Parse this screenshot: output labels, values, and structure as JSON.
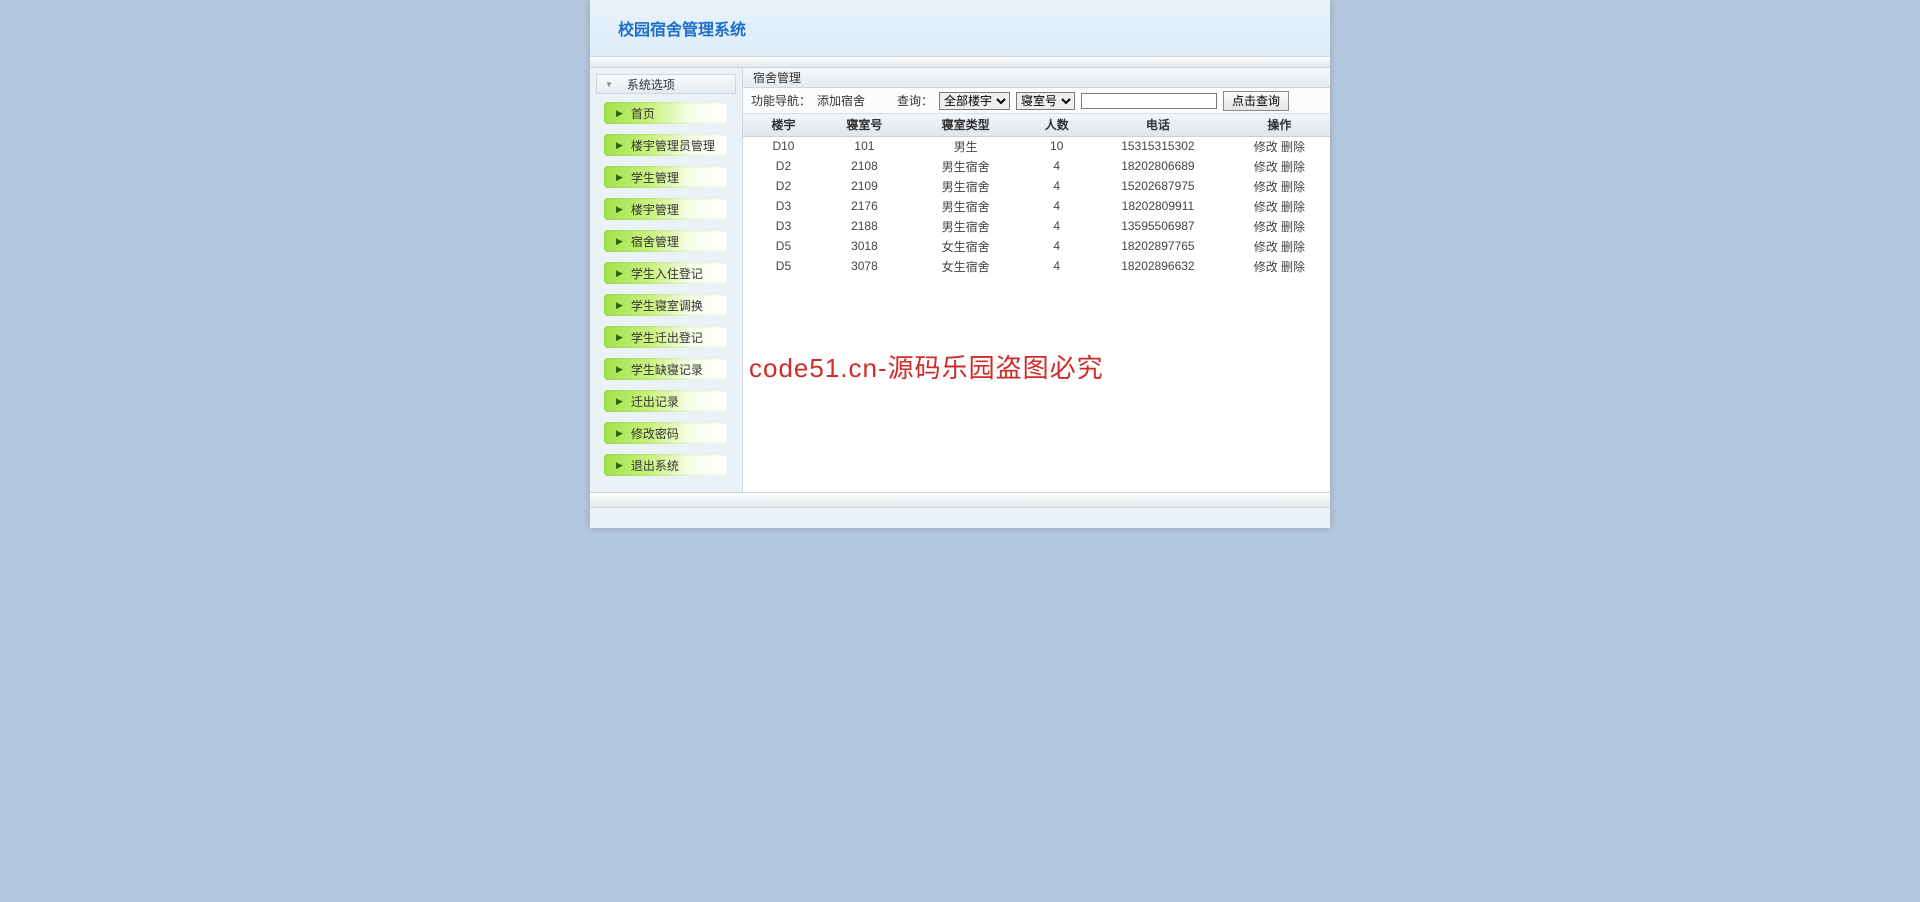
{
  "header": {
    "title": "校园宿舍管理系统"
  },
  "sidebar": {
    "header": "系统选项",
    "items": [
      {
        "label": "首页"
      },
      {
        "label": "楼宇管理员管理"
      },
      {
        "label": "学生管理"
      },
      {
        "label": "楼宇管理"
      },
      {
        "label": "宿舍管理"
      },
      {
        "label": "学生入住登记"
      },
      {
        "label": "学生寝室调换"
      },
      {
        "label": "学生迁出登记"
      },
      {
        "label": "学生缺寝记录"
      },
      {
        "label": "迁出记录"
      },
      {
        "label": "修改密码"
      },
      {
        "label": "退出系统"
      }
    ]
  },
  "panel": {
    "title": "宿舍管理",
    "nav_label": "功能导航：",
    "add_link": "添加宿舍",
    "query_label": "查询：",
    "select_building": "全部楼宇",
    "select_field": "寝室号",
    "search_value": "",
    "search_button": "点击查询"
  },
  "table": {
    "columns": [
      "楼宇",
      "寝室号",
      "寝室类型",
      "人数",
      "电话",
      "操作"
    ],
    "action_edit": "修改",
    "action_delete": "删除",
    "rows": [
      {
        "building": "D10",
        "room": "101",
        "type": "男生",
        "count": "10",
        "phone": "15315315302"
      },
      {
        "building": "D2",
        "room": "2108",
        "type": "男生宿舍",
        "count": "4",
        "phone": "18202806689"
      },
      {
        "building": "D2",
        "room": "2109",
        "type": "男生宿舍",
        "count": "4",
        "phone": "15202687975"
      },
      {
        "building": "D3",
        "room": "2176",
        "type": "男生宿舍",
        "count": "4",
        "phone": "18202809911"
      },
      {
        "building": "D3",
        "room": "2188",
        "type": "男生宿舍",
        "count": "4",
        "phone": "13595506987"
      },
      {
        "building": "D5",
        "room": "3018",
        "type": "女生宿舍",
        "count": "4",
        "phone": "18202897765"
      },
      {
        "building": "D5",
        "room": "3078",
        "type": "女生宿舍",
        "count": "4",
        "phone": "18202896632"
      }
    ]
  },
  "watermark": "code51.cn-源码乐园盗图必究"
}
